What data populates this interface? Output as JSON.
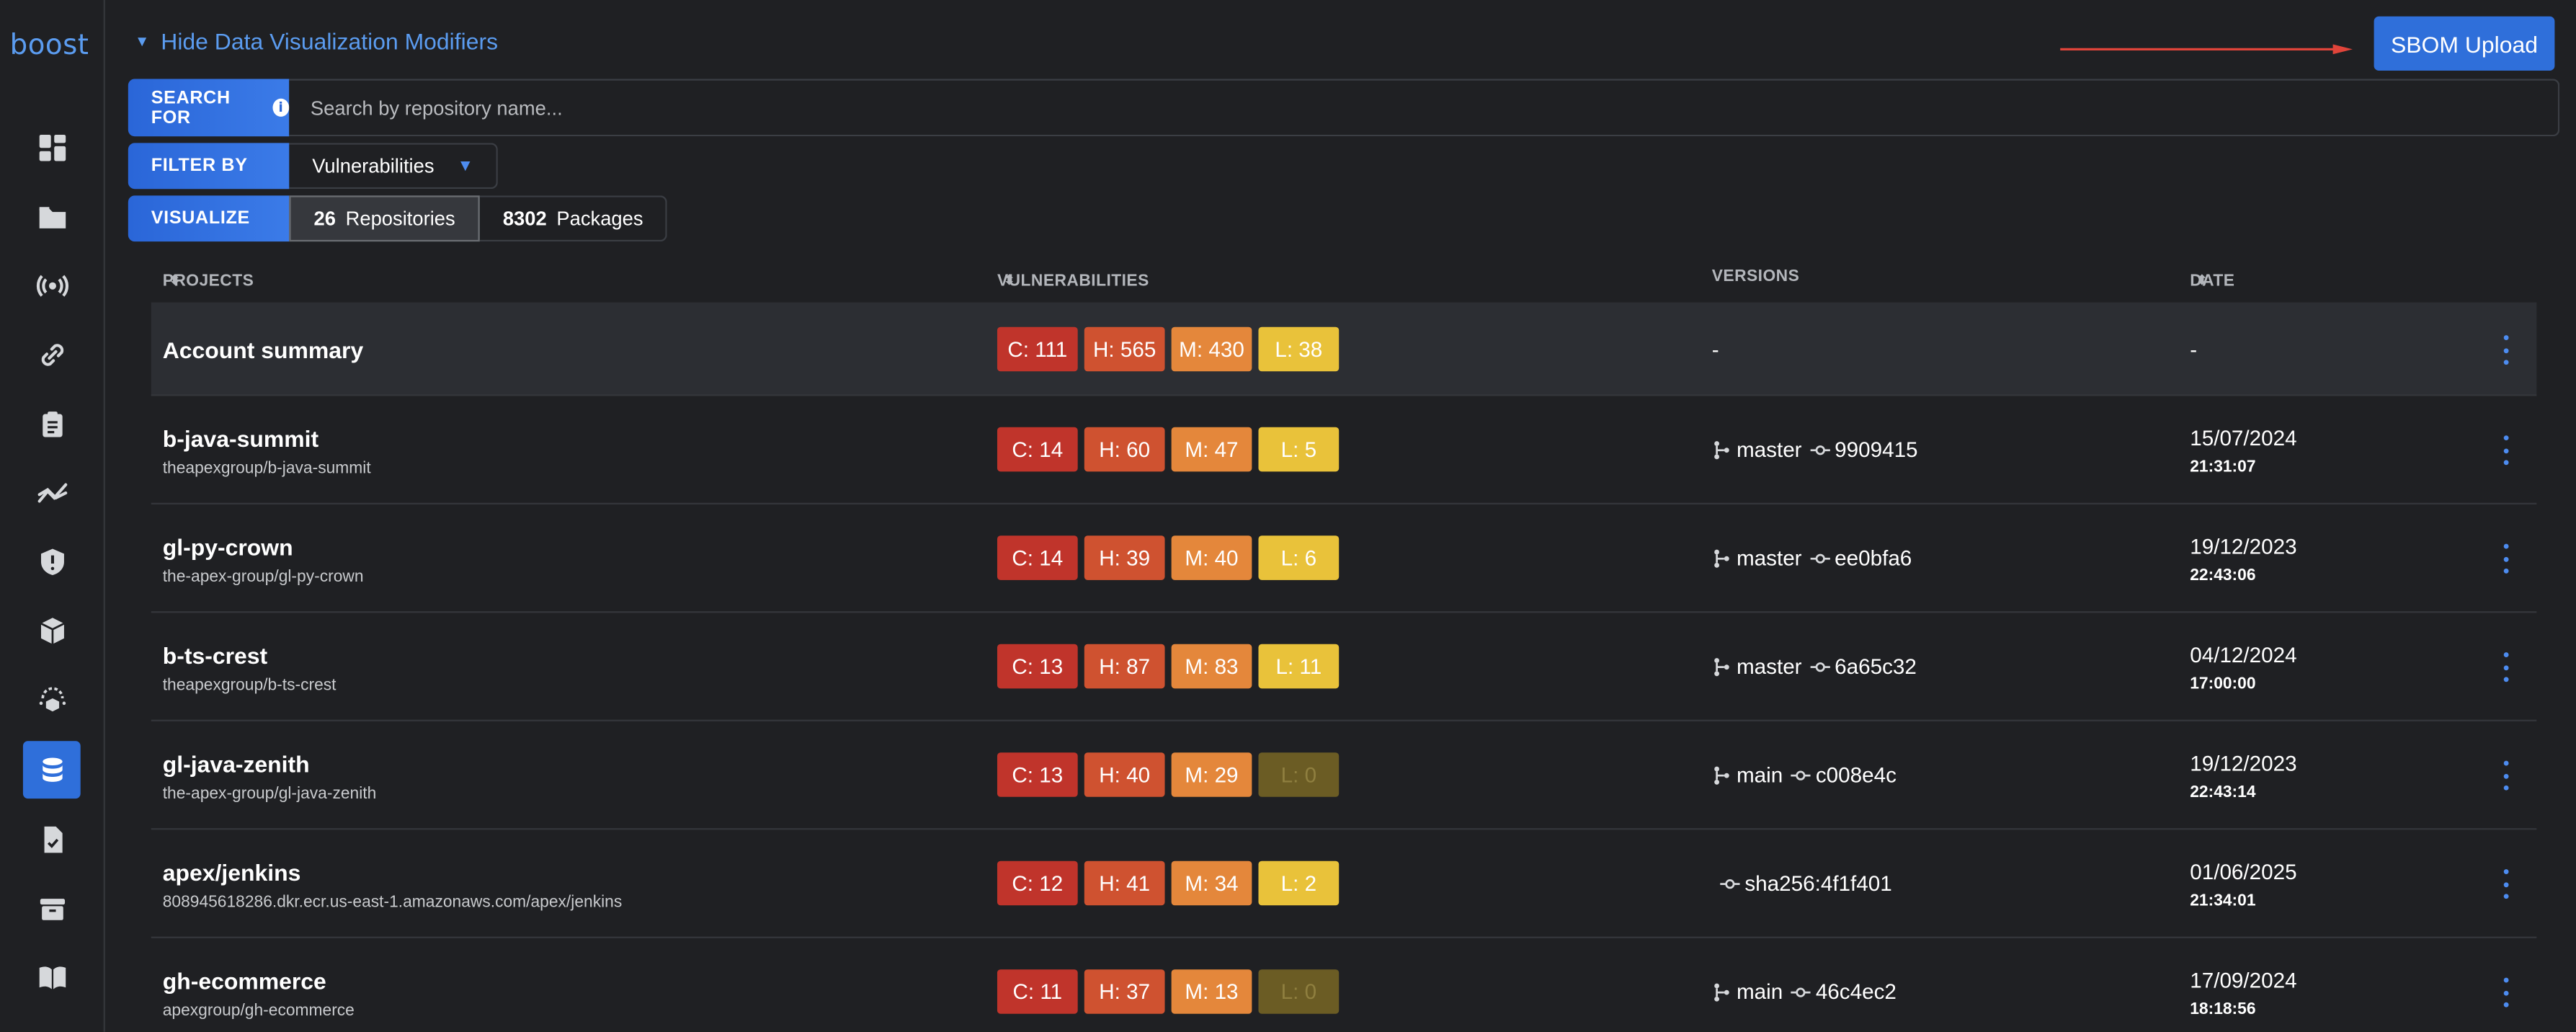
{
  "sidebar": {
    "logo": "boost",
    "items": [
      {
        "icon": "dashboard-icon",
        "active": false
      },
      {
        "icon": "folder-icon",
        "active": false
      },
      {
        "icon": "broadcast-icon",
        "active": false
      },
      {
        "icon": "link-icon",
        "active": false
      },
      {
        "icon": "clipboard-icon",
        "active": false
      },
      {
        "icon": "trend-icon",
        "active": false
      },
      {
        "icon": "shield-alert-icon",
        "active": false
      },
      {
        "icon": "package-icon",
        "active": false
      },
      {
        "icon": "cloud-sync-icon",
        "active": false
      },
      {
        "icon": "database-icon",
        "active": true
      },
      {
        "icon": "file-check-icon",
        "active": false
      },
      {
        "icon": "archive-icon",
        "active": false
      },
      {
        "icon": "book-icon",
        "active": false
      }
    ]
  },
  "header": {
    "toggle_label": "Hide Data Visualization Modifiers",
    "upload_label": "SBOM Upload",
    "arrow_color": "#e0443a"
  },
  "controls": {
    "search_label": "SEARCH FOR",
    "search_placeholder": "Search by repository name...",
    "filter_label": "FILTER BY",
    "filter_value": "Vulnerabilities",
    "visualize_label": "VISUALIZE",
    "repos_count": "26",
    "repos_label": "Repositories",
    "packages_count": "8302",
    "packages_label": "Packages"
  },
  "table": {
    "headers": {
      "projects": "PROJECTS",
      "vulnerabilities": "VULNERABILITIES",
      "versions": "VERSIONS",
      "date": "DATE"
    },
    "summary": {
      "name": "Account summary",
      "c": "C: 111",
      "h": "H: 565",
      "m": "M: 430",
      "l": "L: 38",
      "version": "-",
      "date": "-"
    },
    "rows": [
      {
        "name": "b-java-summit",
        "path": "theapexgroup/b-java-summit",
        "c": "C: 14",
        "h": "H: 60",
        "m": "M: 47",
        "l": "L: 5",
        "l_zero": false,
        "branch": "master",
        "commit": "9909415",
        "date": "15/07/2024",
        "time": "21:31:07"
      },
      {
        "name": "gl-py-crown",
        "path": "the-apex-group/gl-py-crown",
        "c": "C: 14",
        "h": "H: 39",
        "m": "M: 40",
        "l": "L: 6",
        "l_zero": false,
        "branch": "master",
        "commit": "ee0bfa6",
        "date": "19/12/2023",
        "time": "22:43:06"
      },
      {
        "name": "b-ts-crest",
        "path": "theapexgroup/b-ts-crest",
        "c": "C: 13",
        "h": "H: 87",
        "m": "M: 83",
        "l": "L: 11",
        "l_zero": false,
        "branch": "master",
        "commit": "6a65c32",
        "date": "04/12/2024",
        "time": "17:00:00"
      },
      {
        "name": "gl-java-zenith",
        "path": "the-apex-group/gl-java-zenith",
        "c": "C: 13",
        "h": "H: 40",
        "m": "M: 29",
        "l": "L: 0",
        "l_zero": true,
        "branch": "main",
        "commit": "c008e4c",
        "date": "19/12/2023",
        "time": "22:43:14"
      },
      {
        "name": "apex/jenkins",
        "path": "808945618286.dkr.ecr.us-east-1.amazonaws.com/apex/jenkins",
        "c": "C: 12",
        "h": "H: 41",
        "m": "M: 34",
        "l": "L: 2",
        "l_zero": false,
        "branch": "",
        "commit": "sha256:4f1f401",
        "date": "01/06/2025",
        "time": "21:34:01"
      },
      {
        "name": "gh-ecommerce",
        "path": "apexgroup/gh-ecommerce",
        "c": "C: 11",
        "h": "H: 37",
        "m": "M: 13",
        "l": "L: 0",
        "l_zero": true,
        "branch": "main",
        "commit": "46c4ec2",
        "date": "17/09/2024",
        "time": "18:18:56"
      }
    ]
  }
}
